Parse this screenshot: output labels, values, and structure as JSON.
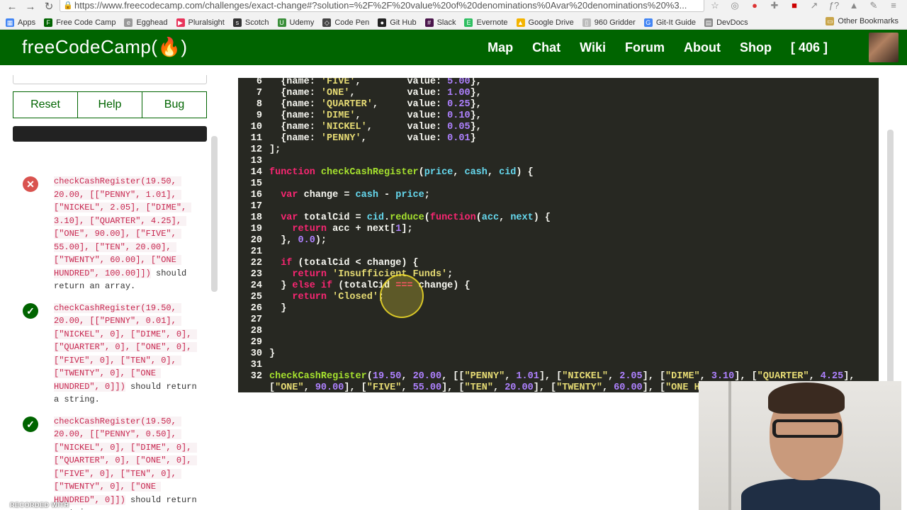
{
  "browser": {
    "url": "https://www.freecodecamp.com/challenges/exact-change#?solution=%2F%2F%20value%20of%20denominations%0Avar%20denominations%20%3...",
    "bookmarks": [
      "Apps",
      "Free Code Camp",
      "Egghead",
      "Pluralsight",
      "Scotch",
      "Udemy",
      "Code Pen",
      "Git Hub",
      "Slack",
      "Evernote",
      "Google Drive",
      "960 Gridder",
      "Git-It Guide",
      "DevDocs"
    ],
    "other_bookmarks": "Other Bookmarks"
  },
  "nav": {
    "logo": "freeCodeCamp(🔥)",
    "links": [
      "Map",
      "Chat",
      "Wiki",
      "Forum",
      "About",
      "Shop"
    ],
    "points": "[ 406 ]"
  },
  "controls": {
    "reset": "Reset",
    "help": "Help",
    "bug": "Bug"
  },
  "tests": [
    {
      "status": "fail",
      "code": "checkCashRegister(19.50, 20.00, [[\"PENNY\", 1.01], [\"NICKEL\", 2.05], [\"DIME\", 3.10], [\"QUARTER\", 4.25], [\"ONE\", 90.00], [\"FIVE\", 55.00], [\"TEN\", 20.00], [\"TWENTY\", 60.00], [\"ONE HUNDRED\", 100.00]])",
      "text": " should return an array."
    },
    {
      "status": "pass",
      "code": "checkCashRegister(19.50, 20.00, [[\"PENNY\", 0.01], [\"NICKEL\", 0], [\"DIME\", 0], [\"QUARTER\", 0], [\"ONE\", 0], [\"FIVE\", 0], [\"TEN\", 0], [\"TWENTY\", 0], [\"ONE HUNDRED\", 0]])",
      "text": " should return a string."
    },
    {
      "status": "pass",
      "code": "checkCashRegister(19.50, 20.00, [[\"PENNY\", 0.50], [\"NICKEL\", 0], [\"DIME\", 0], [\"QUARTER\", 0], [\"ONE\", 0], [\"FIVE\", 0], [\"TEN\", 0], [\"TWENTY\", 0], [\"ONE HUNDRED\", 0]])",
      "text": " should return a string."
    }
  ],
  "editor_lines": [
    {
      "n": "6",
      "tokens": [
        [
          "t",
          "  {name: "
        ],
        [
          "s",
          "'FIVE'"
        ],
        [
          "t",
          ",        value: "
        ],
        [
          "n",
          "5.00"
        ],
        [
          "t",
          "},"
        ]
      ]
    },
    {
      "n": "7",
      "tokens": [
        [
          "t",
          "  {name: "
        ],
        [
          "s",
          "'ONE'"
        ],
        [
          "t",
          ",         value: "
        ],
        [
          "n",
          "1.00"
        ],
        [
          "t",
          "},"
        ]
      ]
    },
    {
      "n": "8",
      "tokens": [
        [
          "t",
          "  {name: "
        ],
        [
          "s",
          "'QUARTER'"
        ],
        [
          "t",
          ",     value: "
        ],
        [
          "n",
          "0.25"
        ],
        [
          "t",
          "},"
        ]
      ]
    },
    {
      "n": "9",
      "tokens": [
        [
          "t",
          "  {name: "
        ],
        [
          "s",
          "'DIME'"
        ],
        [
          "t",
          ",        value: "
        ],
        [
          "n",
          "0.10"
        ],
        [
          "t",
          "},"
        ]
      ]
    },
    {
      "n": "10",
      "tokens": [
        [
          "t",
          "  {name: "
        ],
        [
          "s",
          "'NICKEL'"
        ],
        [
          "t",
          ",      value: "
        ],
        [
          "n",
          "0.05"
        ],
        [
          "t",
          "},"
        ]
      ]
    },
    {
      "n": "11",
      "tokens": [
        [
          "t",
          "  {name: "
        ],
        [
          "s",
          "'PENNY'"
        ],
        [
          "t",
          ",       value: "
        ],
        [
          "n",
          "0.01"
        ],
        [
          "t",
          "}"
        ]
      ]
    },
    {
      "n": "12",
      "tokens": [
        [
          "t",
          "];"
        ]
      ]
    },
    {
      "n": "13",
      "tokens": []
    },
    {
      "n": "14",
      "tokens": [
        [
          "k",
          "function "
        ],
        [
          "f",
          "checkCashRegister"
        ],
        [
          "t",
          "("
        ],
        [
          "v",
          "price"
        ],
        [
          "t",
          ", "
        ],
        [
          "v",
          "cash"
        ],
        [
          "t",
          ", "
        ],
        [
          "v",
          "cid"
        ],
        [
          "t",
          ") {"
        ]
      ]
    },
    {
      "n": "15",
      "tokens": []
    },
    {
      "n": "16",
      "tokens": [
        [
          "t",
          "  "
        ],
        [
          "k",
          "var "
        ],
        [
          "t",
          "change = "
        ],
        [
          "v",
          "cash"
        ],
        [
          "t",
          " - "
        ],
        [
          "v",
          "price"
        ],
        [
          "t",
          ";"
        ]
      ]
    },
    {
      "n": "17",
      "tokens": []
    },
    {
      "n": "18",
      "tokens": [
        [
          "t",
          "  "
        ],
        [
          "k",
          "var "
        ],
        [
          "t",
          "totalCid = "
        ],
        [
          "v",
          "cid"
        ],
        [
          "t",
          "."
        ],
        [
          "f",
          "reduce"
        ],
        [
          "t",
          "("
        ],
        [
          "k",
          "function"
        ],
        [
          "t",
          "("
        ],
        [
          "v",
          "acc"
        ],
        [
          "t",
          ", "
        ],
        [
          "v",
          "next"
        ],
        [
          "t",
          ") {"
        ]
      ]
    },
    {
      "n": "19",
      "tokens": [
        [
          "t",
          "    "
        ],
        [
          "k",
          "return "
        ],
        [
          "t",
          "acc + next["
        ],
        [
          "n",
          "1"
        ],
        [
          "t",
          "];"
        ]
      ]
    },
    {
      "n": "20",
      "tokens": [
        [
          "t",
          "  }, "
        ],
        [
          "n",
          "0.0"
        ],
        [
          "t",
          ");"
        ]
      ]
    },
    {
      "n": "21",
      "tokens": []
    },
    {
      "n": "22",
      "tokens": [
        [
          "t",
          "  "
        ],
        [
          "k",
          "if "
        ],
        [
          "t",
          "(totalCid < change) {"
        ]
      ]
    },
    {
      "n": "23",
      "tokens": [
        [
          "t",
          "    "
        ],
        [
          "k",
          "return "
        ],
        [
          "s",
          "'Insufficient Funds'"
        ],
        [
          "t",
          ";"
        ]
      ]
    },
    {
      "n": "24",
      "tokens": [
        [
          "t",
          "  } "
        ],
        [
          "k",
          "else if "
        ],
        [
          "t",
          "(totalCid "
        ],
        [
          "k",
          "==="
        ],
        [
          "t",
          " change) {"
        ]
      ]
    },
    {
      "n": "25",
      "tokens": [
        [
          "t",
          "    "
        ],
        [
          "k",
          "return "
        ],
        [
          "s",
          "'Closed'"
        ],
        [
          "t",
          ";"
        ]
      ]
    },
    {
      "n": "26",
      "tokens": [
        [
          "t",
          "  }"
        ]
      ]
    },
    {
      "n": "27",
      "tokens": []
    },
    {
      "n": "28",
      "tokens": []
    },
    {
      "n": "29",
      "tokens": []
    },
    {
      "n": "30",
      "tokens": [
        [
          "t",
          "}"
        ]
      ]
    },
    {
      "n": "31",
      "tokens": []
    },
    {
      "n": "32",
      "tokens": [
        [
          "f",
          "checkCashRegister"
        ],
        [
          "t",
          "("
        ],
        [
          "n",
          "19.50"
        ],
        [
          "t",
          ", "
        ],
        [
          "n",
          "20.00"
        ],
        [
          "t",
          ", [["
        ],
        [
          "s",
          "\"PENNY\""
        ],
        [
          "t",
          ", "
        ],
        [
          "n",
          "1.01"
        ],
        [
          "t",
          "], ["
        ],
        [
          "s",
          "\"NICKEL\""
        ],
        [
          "t",
          ", "
        ],
        [
          "n",
          "2.05"
        ],
        [
          "t",
          "], ["
        ],
        [
          "s",
          "\"DIME\""
        ],
        [
          "t",
          ", "
        ],
        [
          "n",
          "3.10"
        ],
        [
          "t",
          "], ["
        ],
        [
          "s",
          "\"QUARTER\""
        ],
        [
          "t",
          ", "
        ],
        [
          "n",
          "4.25"
        ],
        [
          "t",
          "],"
        ]
      ]
    },
    {
      "n": "",
      "tokens": [
        [
          "t",
          "["
        ],
        [
          "s",
          "\"ONE\""
        ],
        [
          "t",
          ", "
        ],
        [
          "n",
          "90.00"
        ],
        [
          "t",
          "], ["
        ],
        [
          "s",
          "\"FIVE\""
        ],
        [
          "t",
          ", "
        ],
        [
          "n",
          "55.00"
        ],
        [
          "t",
          "], ["
        ],
        [
          "s",
          "\"TEN\""
        ],
        [
          "t",
          ", "
        ],
        [
          "n",
          "20.00"
        ],
        [
          "t",
          "], ["
        ],
        [
          "s",
          "\"TWENTY\""
        ],
        [
          "t",
          ", "
        ],
        [
          "n",
          "60.00"
        ],
        [
          "t",
          "], ["
        ],
        [
          "s",
          "\"ONE HU"
        ]
      ]
    }
  ],
  "watermark": "RECORDED WITH"
}
